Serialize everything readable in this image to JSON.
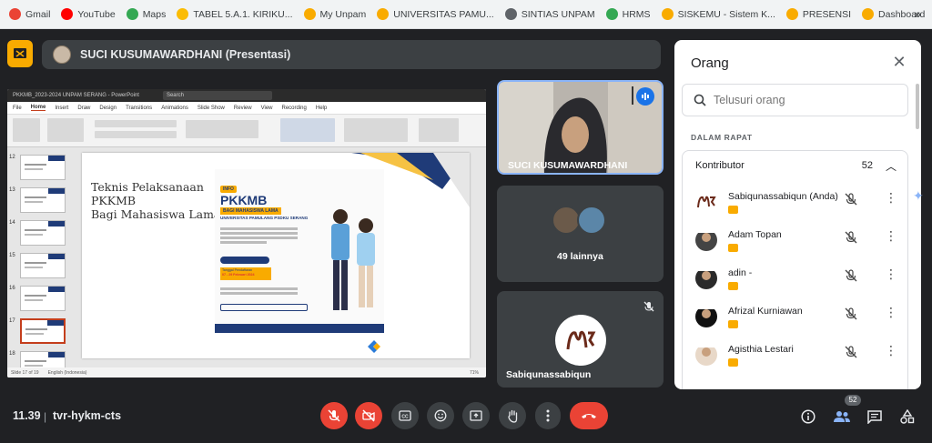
{
  "bookmarks": [
    {
      "label": "Gmail",
      "icon": "gmail-icon",
      "color": "#ea4335"
    },
    {
      "label": "YouTube",
      "icon": "youtube-icon",
      "color": "#ff0000"
    },
    {
      "label": "Maps",
      "icon": "maps-icon",
      "color": "#34a853"
    },
    {
      "label": "TABEL 5.A.1. KIRIKU...",
      "icon": "drive-icon",
      "color": "#fbbc04"
    },
    {
      "label": "My Unpam",
      "icon": "unpam-icon",
      "color": "#f9ab00"
    },
    {
      "label": "UNIVERSITAS PAMU...",
      "icon": "unpam-icon",
      "color": "#f9ab00"
    },
    {
      "label": "SINTIAS UNPAM",
      "icon": "globe-icon",
      "color": "#5f6368"
    },
    {
      "label": "HRMS",
      "icon": "hrms-icon",
      "color": "#34a853"
    },
    {
      "label": "SISKEMU - Sistem K...",
      "icon": "unpam-icon",
      "color": "#f9ab00"
    },
    {
      "label": "PRESENSI",
      "icon": "unpam-icon",
      "color": "#f9ab00"
    },
    {
      "label": "Dashboard",
      "icon": "unpam-icon",
      "color": "#f9ab00"
    }
  ],
  "presenter": {
    "label": "SUCI KUSUMAWARDHANI (Presentasi)"
  },
  "slide": {
    "title_lines": [
      "Teknis Pelaksanaan",
      "PKKMB",
      "Bagi Mahasiswa Lama"
    ],
    "poster_info": "INFO",
    "poster_title": "PKKMB",
    "poster_sub1": "BAGI MAHASISWA LAMA",
    "poster_sub2": "UNIVERSITAS PAMULANG PSDKU SERANG",
    "poster_tagline": "Tanggal Pendaftaran",
    "poster_date": "07 - 29 Februari 2024",
    "ppt_file": "PKKMB_2023-2024 UNPAM SERANG - PowerPoint",
    "ppt_search": "Search",
    "ppt_tabs": [
      "File",
      "Home",
      "Insert",
      "Draw",
      "Design",
      "Transitions",
      "Animations",
      "Slide Show",
      "Review",
      "View",
      "Recording",
      "Help"
    ],
    "status": "Slide 17 of 19",
    "lang": "English (Indonesia)",
    "zoom": "71%"
  },
  "thumbnails": [
    "12",
    "13",
    "14",
    "15",
    "16",
    "17",
    "18"
  ],
  "tiles": {
    "speaker": "SUCI KUSUMAWARDHANI",
    "others": "49 lainnya",
    "self": "Sabiqunassabiqun"
  },
  "panel": {
    "title": "Orang",
    "search_placeholder": "Telusuri orang",
    "section": "DALAM RAPAT",
    "group": "Kontributor",
    "count": "52",
    "people": [
      {
        "name": "Sabiqunassabiqun (Anda)",
        "avatar": "logo"
      },
      {
        "name": "Adam Topan",
        "avatar": "photo"
      },
      {
        "name": "adin -",
        "avatar": "photo"
      },
      {
        "name": "Afrizal Kurniawan",
        "avatar": "photo"
      },
      {
        "name": "Agisthia Lestari",
        "avatar": "photo"
      }
    ]
  },
  "bottom": {
    "time": "11.39",
    "code": "tvr-hykm-cts",
    "people_count": "52"
  },
  "colors": {
    "accent": "#f9ab00",
    "danger": "#ea4335",
    "dark": "#202124",
    "tile": "#3c4043"
  }
}
